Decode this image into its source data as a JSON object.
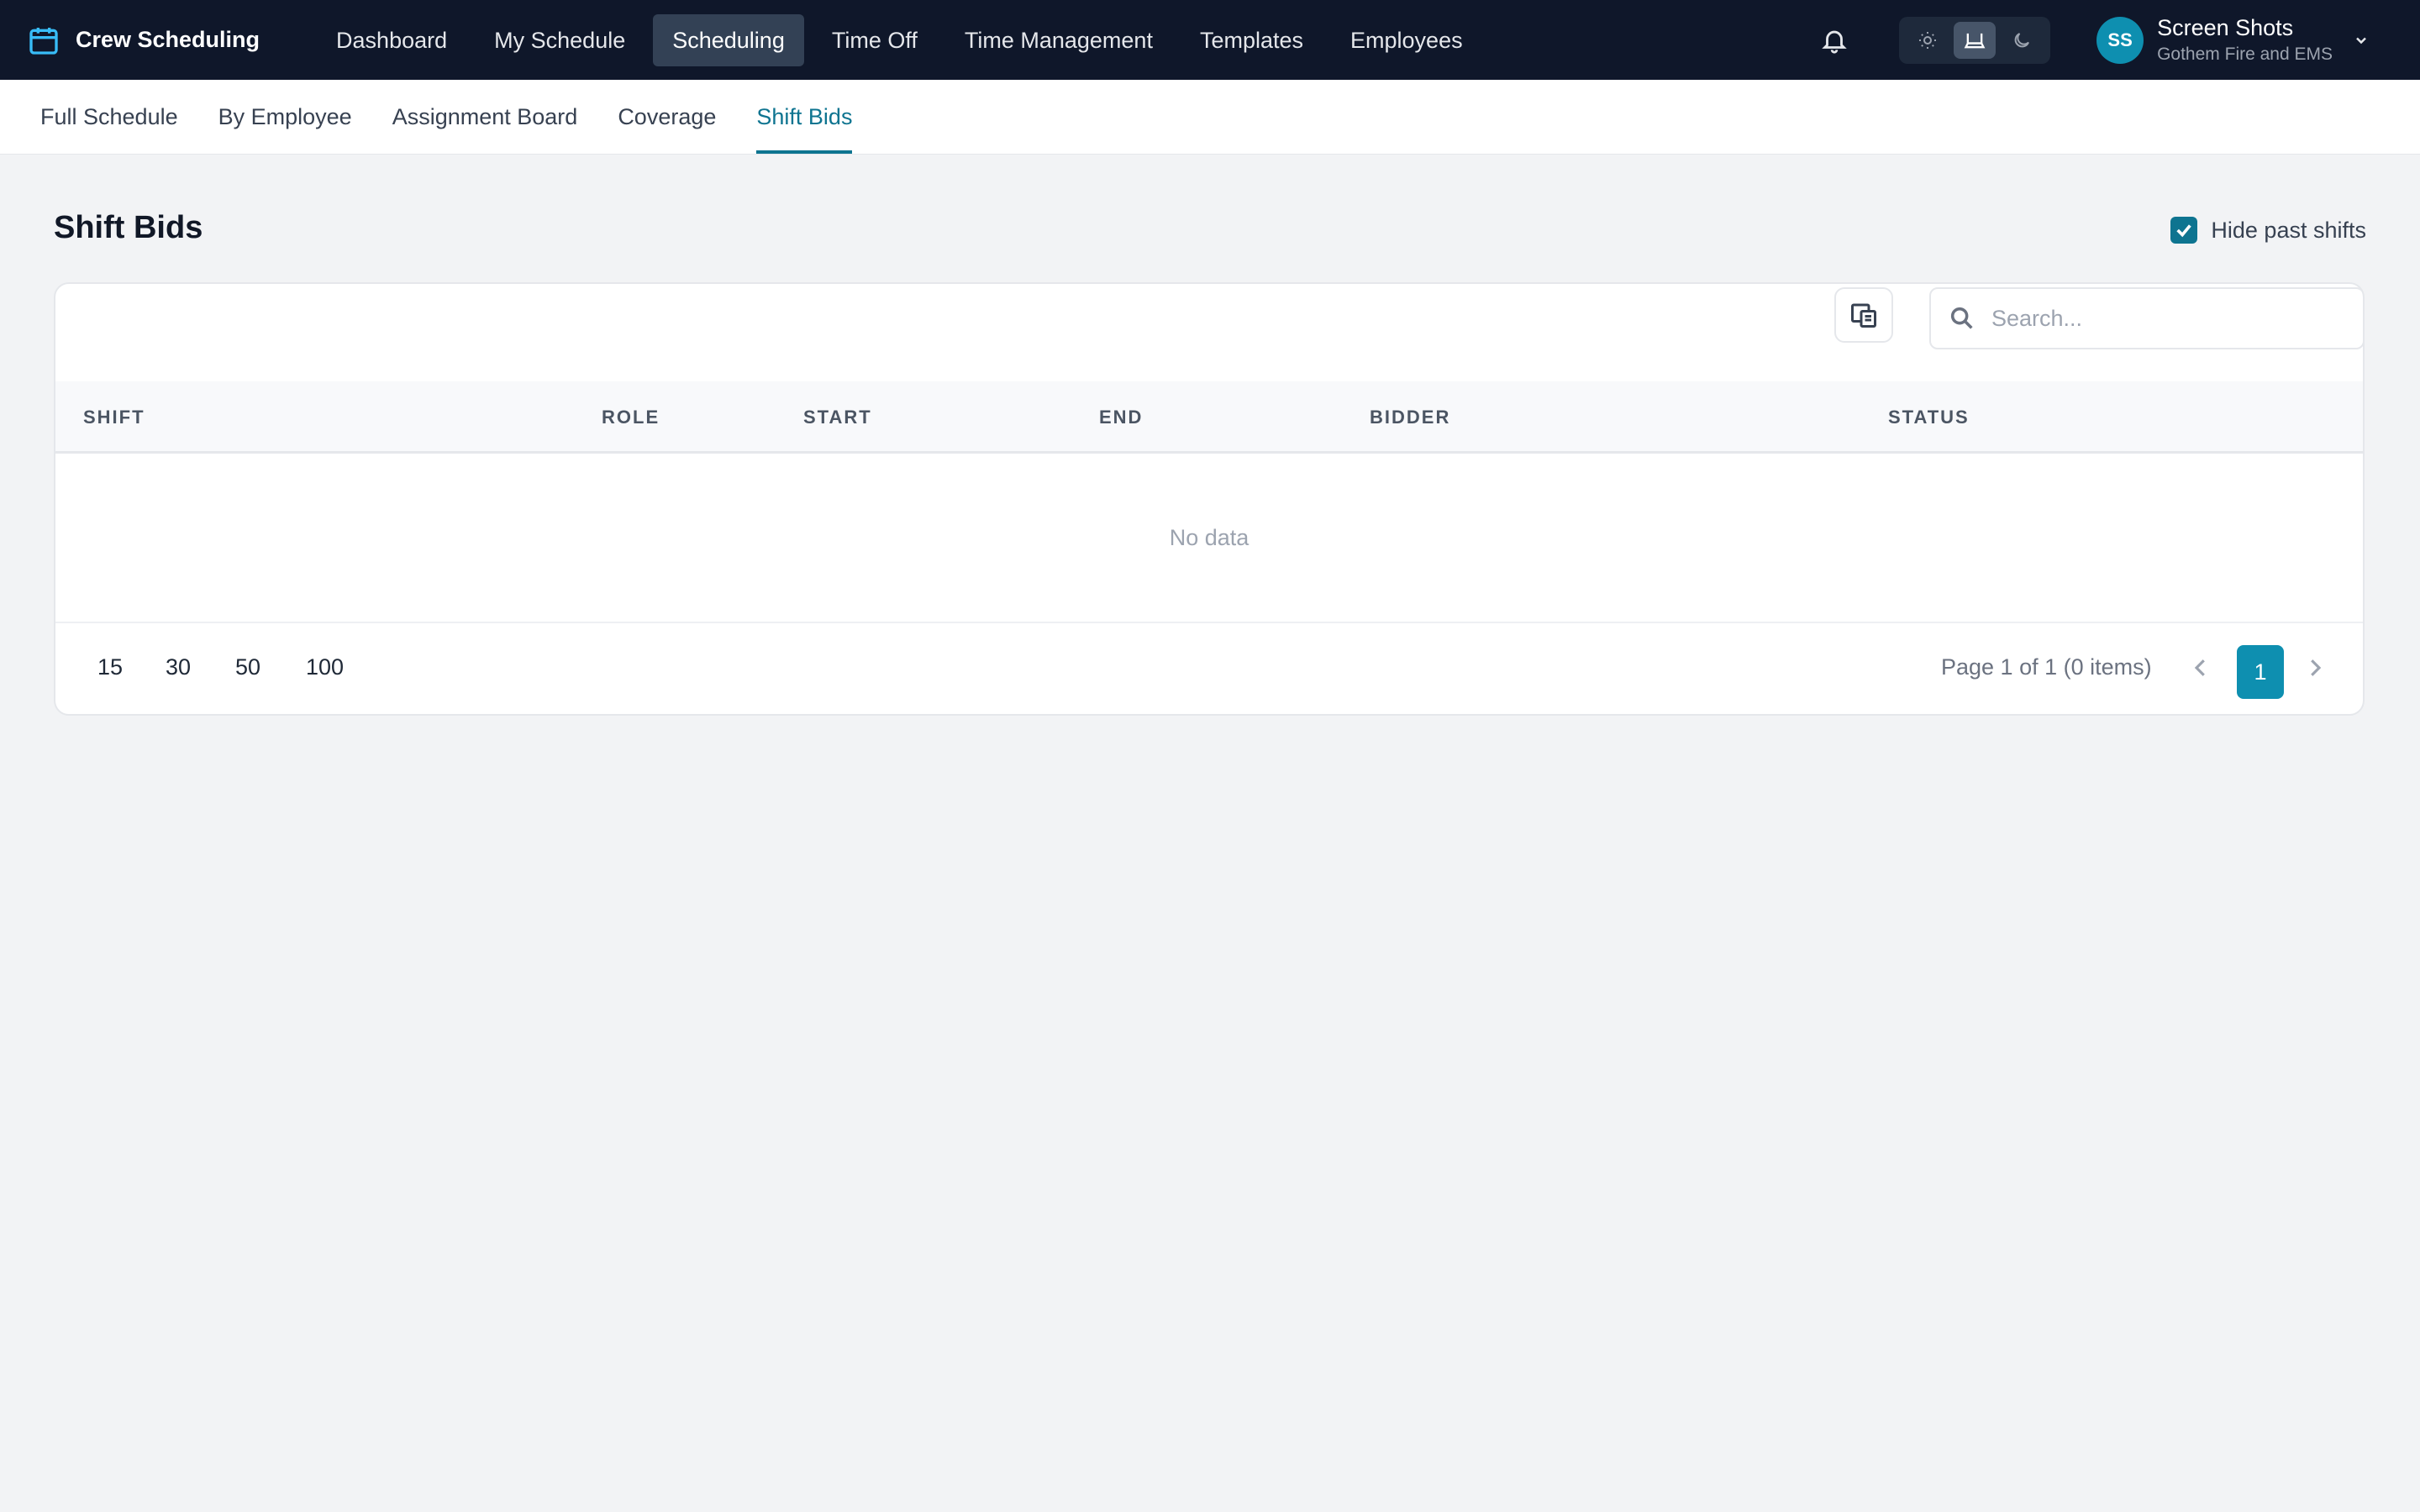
{
  "app": {
    "title": "Crew Scheduling"
  },
  "nav": {
    "items": [
      {
        "label": "Dashboard"
      },
      {
        "label": "My Schedule"
      },
      {
        "label": "Scheduling"
      },
      {
        "label": "Time Off"
      },
      {
        "label": "Time Management"
      },
      {
        "label": "Templates"
      },
      {
        "label": "Employees"
      }
    ],
    "active": "Scheduling"
  },
  "theme": {
    "selected": "system"
  },
  "user": {
    "initials": "SS",
    "name": "Screen Shots",
    "org": "Gothem Fire and EMS"
  },
  "subnav": {
    "items": [
      {
        "label": "Full Schedule"
      },
      {
        "label": "By Employee"
      },
      {
        "label": "Assignment Board"
      },
      {
        "label": "Coverage"
      },
      {
        "label": "Shift Bids"
      }
    ],
    "active": "Shift Bids"
  },
  "page": {
    "title": "Shift Bids",
    "hide_past_label": "Hide past shifts",
    "hide_past_checked": true
  },
  "search": {
    "placeholder": "Search..."
  },
  "table": {
    "columns": [
      "SHIFT",
      "ROLE",
      "START",
      "END",
      "BIDDER",
      "STATUS"
    ],
    "empty_text": "No data"
  },
  "pager": {
    "page_sizes": [
      "15",
      "30",
      "50",
      "100"
    ],
    "info": "Page 1 of 1 (0 items)",
    "current_page": "1"
  },
  "colors": {
    "accent": "#0e7490",
    "topbar": "#0f172a",
    "avatar": "#0e8fb0"
  }
}
